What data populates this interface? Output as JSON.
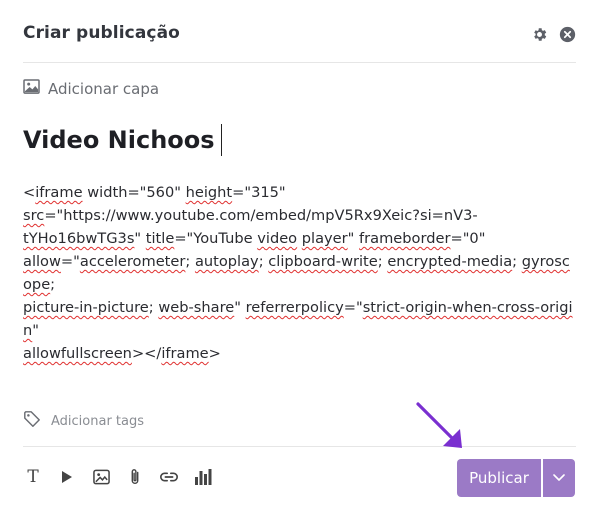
{
  "header": {
    "title": "Criar publicação",
    "settings_icon": "gear-icon",
    "close_icon": "close-circle-icon"
  },
  "cover": {
    "label": "Adicionar capa",
    "icon": "image-icon"
  },
  "post": {
    "title": "Video Nichoos",
    "body_segments": [
      {
        "text": "<",
        "spell": false
      },
      {
        "text": "iframe",
        "spell": true
      },
      {
        "text": " width=\"560\" ",
        "spell": false
      },
      {
        "text": "height",
        "spell": true
      },
      {
        "text": "=\"315\"\n",
        "spell": false
      },
      {
        "text": "src",
        "spell": true
      },
      {
        "text": "=\"https://www.youtube.com/embed/mpV5Rx9Xeic?si=nV3-\n",
        "spell": false
      },
      {
        "text": "tYHo16bwTG3s",
        "spell": true
      },
      {
        "text": "\" ",
        "spell": false
      },
      {
        "text": "title",
        "spell": true
      },
      {
        "text": "=\"YouTube ",
        "spell": false
      },
      {
        "text": "video",
        "spell": true
      },
      {
        "text": " ",
        "spell": false
      },
      {
        "text": "player",
        "spell": true
      },
      {
        "text": "\" ",
        "spell": false
      },
      {
        "text": "frameborder",
        "spell": true
      },
      {
        "text": "=\"0\"\n",
        "spell": false
      },
      {
        "text": "allow",
        "spell": true
      },
      {
        "text": "=\"",
        "spell": false
      },
      {
        "text": "accelerometer",
        "spell": true
      },
      {
        "text": "; ",
        "spell": false
      },
      {
        "text": "autoplay",
        "spell": true
      },
      {
        "text": "; ",
        "spell": false
      },
      {
        "text": "clipboard-write",
        "spell": true
      },
      {
        "text": "; ",
        "spell": false
      },
      {
        "text": "encrypted-media",
        "spell": true
      },
      {
        "text": "; ",
        "spell": false
      },
      {
        "text": "gyroscope",
        "spell": true
      },
      {
        "text": ";\n",
        "spell": false
      },
      {
        "text": "picture-in-picture",
        "spell": true
      },
      {
        "text": "; ",
        "spell": false
      },
      {
        "text": "web-share",
        "spell": true
      },
      {
        "text": "\" ",
        "spell": false
      },
      {
        "text": "referrerpolicy",
        "spell": true
      },
      {
        "text": "=\"",
        "spell": false
      },
      {
        "text": "strict-origin-when-cross-origin",
        "spell": true
      },
      {
        "text": "\"\n",
        "spell": false
      },
      {
        "text": "allowfullscreen",
        "spell": true
      },
      {
        "text": "></",
        "spell": false
      },
      {
        "text": "iframe",
        "spell": true
      },
      {
        "text": ">",
        "spell": false
      }
    ]
  },
  "tags": {
    "label": "Adicionar tags",
    "icon": "tag-icon"
  },
  "toolbar": {
    "tools": [
      {
        "name": "text-format-icon",
        "glyph": "T"
      },
      {
        "name": "video-icon"
      },
      {
        "name": "image-icon"
      },
      {
        "name": "attachment-icon"
      },
      {
        "name": "link-icon"
      },
      {
        "name": "poll-icon"
      }
    ]
  },
  "publish": {
    "label": "Publicar",
    "dropdown_icon": "chevron-down-icon"
  },
  "colors": {
    "accent": "#9b7ac6",
    "arrow": "#7a2fd0",
    "spellcheck": "#e0302f"
  }
}
